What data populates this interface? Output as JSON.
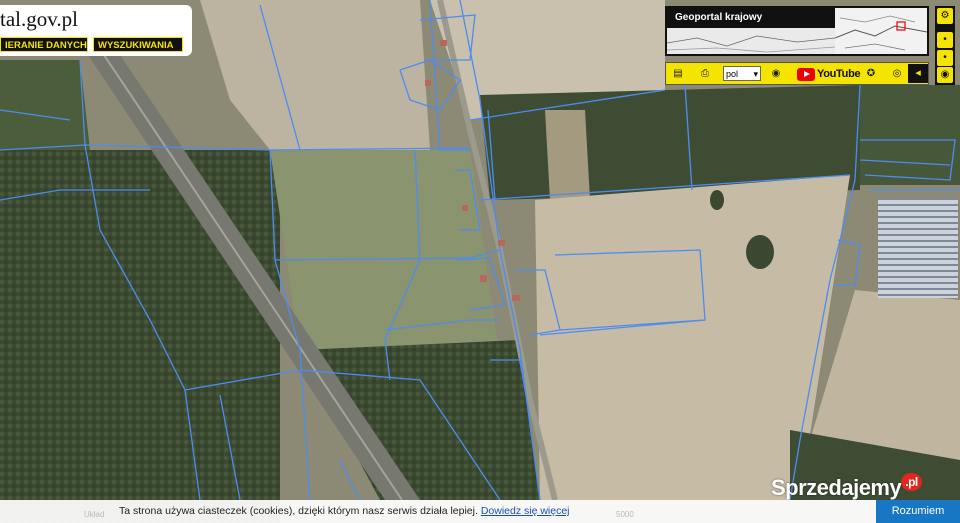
{
  "logo": {
    "site": "tal.gov.pl"
  },
  "tabs": [
    {
      "label": "IERANIE DANYCH"
    },
    {
      "label": "WYSZUKIWANIA"
    }
  ],
  "geoportal": {
    "title": "Geoportal krajowy"
  },
  "toolbar": {
    "lang": "pol",
    "youtube": "YouTube",
    "icons": [
      "document-icon",
      "printer-icon",
      "globe-icon",
      "settings-icon",
      "eye-icon",
      "arrow-left-icon"
    ]
  },
  "rightbar": {
    "icons": [
      "gears-icon",
      "info-icon",
      "info-icon",
      "eye-icon"
    ]
  },
  "cookie": {
    "faint_left": "Układ",
    "message": "Ta strona używa ciasteczek (cookies), dzięki którym nasz serwis działa lepiej.",
    "link": "Dowiedz się więcej",
    "faint_right": "5000",
    "accept": "Rozumiem"
  },
  "watermark": {
    "text": "Sprzedajemy",
    "badge": ".pl"
  },
  "colors": {
    "accent": "#f5e400",
    "parcel_lines": "#4d8cf0",
    "accept": "#1877c5"
  }
}
